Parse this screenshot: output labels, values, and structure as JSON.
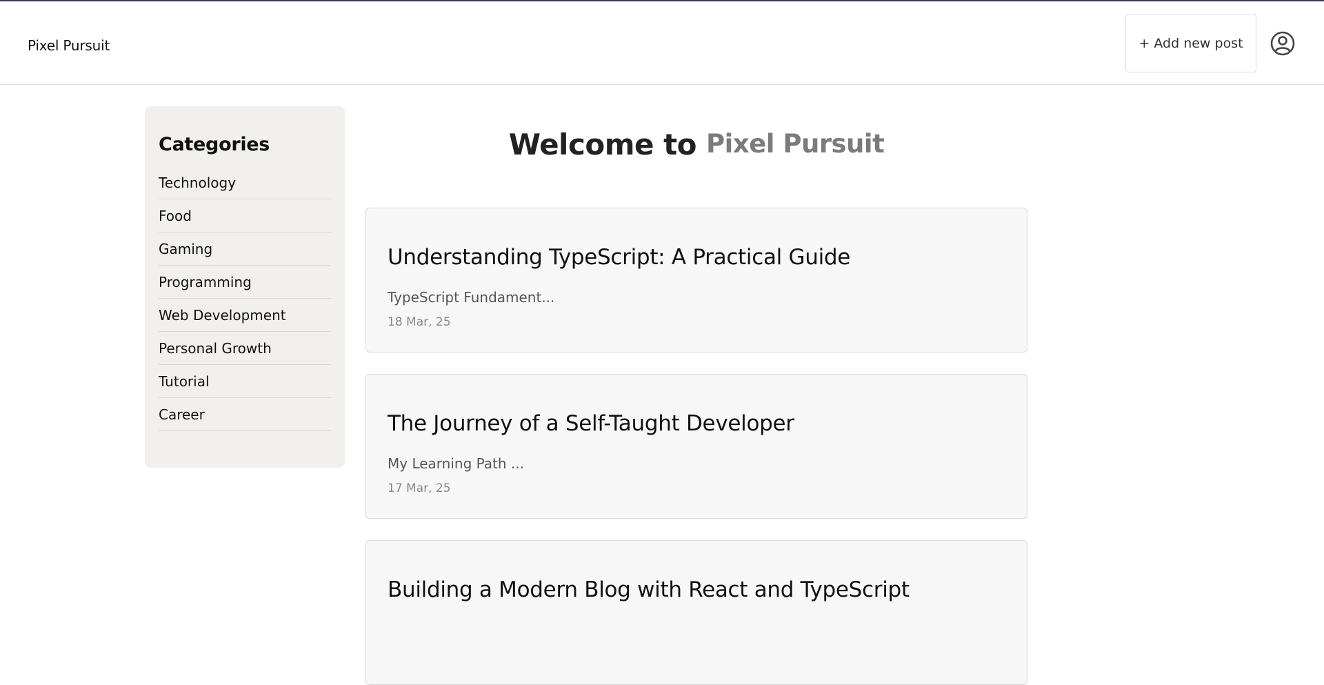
{
  "header": {
    "brand": "Pixel Pursuit",
    "add_post_label": "+ Add new post",
    "avatar_icon": "user-circle-icon"
  },
  "sidebar": {
    "title": "Categories",
    "items": [
      {
        "label": "Technology"
      },
      {
        "label": "Food"
      },
      {
        "label": "Gaming"
      },
      {
        "label": "Programming"
      },
      {
        "label": "Web Development"
      },
      {
        "label": "Personal Growth"
      },
      {
        "label": "Tutorial"
      },
      {
        "label": "Career"
      }
    ]
  },
  "main": {
    "welcome_prefix": "Welcome to",
    "welcome_name": "Pixel Pursuit",
    "posts": [
      {
        "title": "Understanding TypeScript: A Practical Guide",
        "excerpt": "TypeScript Fundament...",
        "date": "18 Mar, 25"
      },
      {
        "title": "The Journey of a Self-Taught Developer",
        "excerpt": "My Learning Path ...",
        "date": "17 Mar, 25"
      },
      {
        "title": "Building a Modern Blog with React and TypeScript",
        "excerpt": "",
        "date": ""
      }
    ]
  },
  "colors": {
    "top_strip": "#3c3c55",
    "sidebar_bg": "#f1f0ee",
    "card_bg": "#f7f7f7",
    "accent_name": "#7b7b7b"
  }
}
